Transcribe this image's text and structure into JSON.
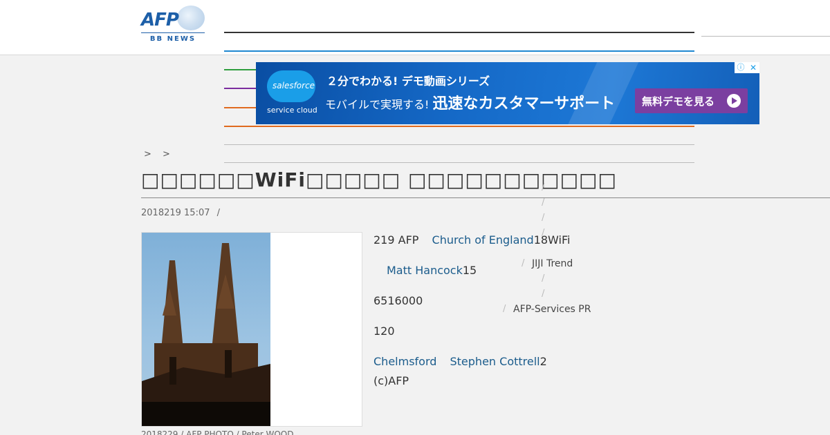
{
  "header": {
    "logo_text": "AFP",
    "logo_sub": "BB NEWS"
  },
  "ad": {
    "brand": "salesforce",
    "brand_sub": "service cloud",
    "line1": "２分でわかる! デモ動画シリーズ",
    "line2_small": "モバイルで実現する!",
    "line2_big": "迅速なカスタマーサポート",
    "cta": "無料デモを見る",
    "adchoices": "ⓘ",
    "close": "✕"
  },
  "breadcrumb": "> >",
  "article": {
    "title": "□□□□□□WiFi□□□□□ □□□□□□□□□□□",
    "date": "2018219 15:07",
    "date_sep": "/",
    "caption": "2018229 / AFP PHOTO / Peter WOOD"
  },
  "body": {
    "p1_a": "219 AFP",
    "p1_link": "Church of England",
    "p1_b": "18WiFi",
    "p2_link": "Matt Hancock",
    "p2_b": "15",
    "p3": "6516000",
    "p4": "120",
    "p5_link1": "Chelmsford",
    "p5_link2": "Stephen Cottrell",
    "p5_b": "2",
    "p6": "(c)AFP"
  },
  "sidebar": {
    "slash": "/",
    "item_jiji": "JIJI Trend",
    "item_afp": "AFP-Services PR"
  },
  "colors": {
    "nav_line_1": "#333333",
    "nav_line_2": "#1e88d0",
    "nav_line_3": "#2e9e3e",
    "nav_line_4": "#7b2c9e",
    "nav_line_5": "#e06a1e",
    "nav_line_6": "#e06a1e",
    "nav_line_7": "#bbbbbb",
    "nav_line_8": "#bbbbbb"
  }
}
